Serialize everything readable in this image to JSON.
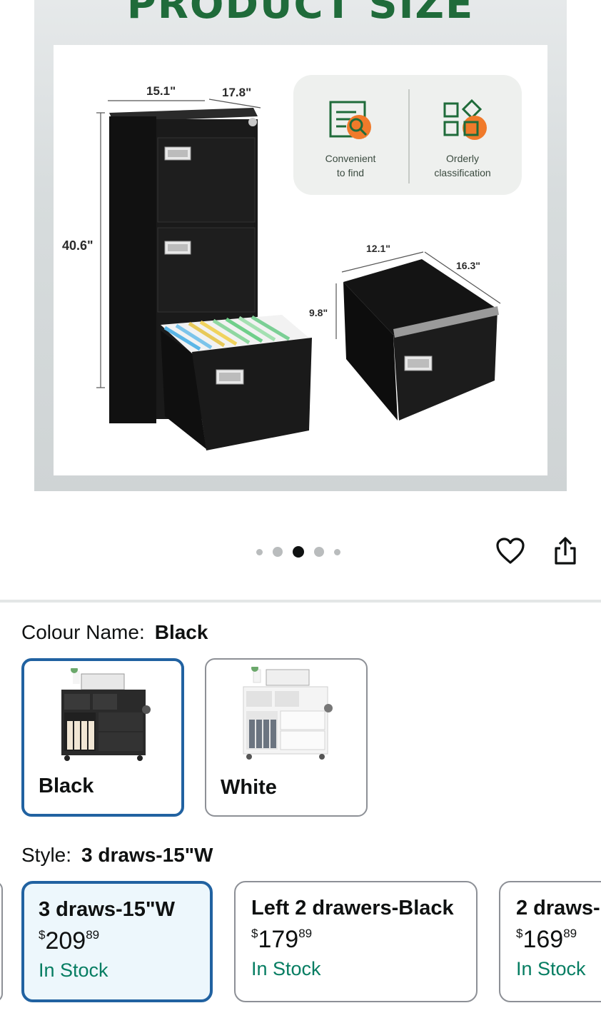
{
  "hero": {
    "title": "PRODUCT SIZE",
    "dimensions": {
      "cabinet_width": "15.1\"",
      "cabinet_depth": "17.8\"",
      "cabinet_height": "40.6\"",
      "drawer_width": "12.1\"",
      "drawer_depth": "16.3\"",
      "drawer_height": "9.8\""
    },
    "features": [
      {
        "line1": "Convenient",
        "line2": "to find",
        "icon": "document-search-icon"
      },
      {
        "line1": "Orderly",
        "line2": "classification",
        "icon": "category-grid-icon"
      }
    ],
    "colors": {
      "title_green": "#1f6b3a",
      "accent_orange": "#f07a2a",
      "icon_green": "#1f6b3a"
    }
  },
  "carousel": {
    "count": 5,
    "active_index": 2
  },
  "actions": {
    "favorite_icon": "heart-icon",
    "share_icon": "share-icon"
  },
  "colour": {
    "label": "Colour Name:",
    "selected": "Black",
    "options": [
      {
        "name": "Black",
        "selected": true
      },
      {
        "name": "White",
        "selected": false
      }
    ]
  },
  "style": {
    "label": "Style:",
    "selected": "3 draws-15\"W",
    "options": [
      {
        "name": "3 draws-15\"W",
        "currency": "$",
        "price_whole": "209",
        "price_fraction": "89",
        "stock": "In Stock",
        "selected": true
      },
      {
        "name": "Left 2 drawers-Black",
        "currency": "$",
        "price_whole": "179",
        "price_fraction": "89",
        "stock": "In Stock",
        "selected": false
      },
      {
        "name": "2 draws-",
        "currency": "$",
        "price_whole": "169",
        "price_fraction": "89",
        "stock": "In Stock",
        "selected": false
      }
    ]
  },
  "theme": {
    "selected_border": "#2162a1",
    "stock_green": "#067d62",
    "selected_bg": "#edf7fc"
  }
}
